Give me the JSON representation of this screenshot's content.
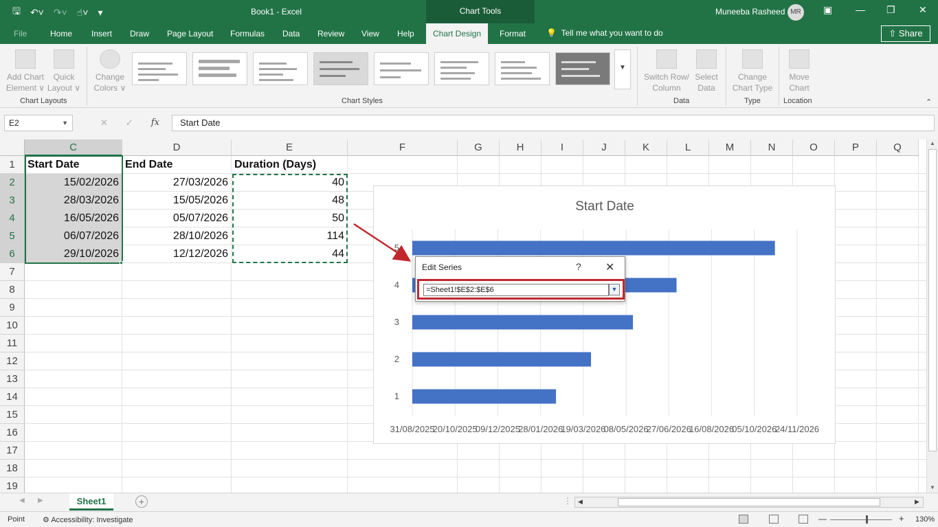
{
  "titlebar": {
    "doc_title": "Book1  -  Excel",
    "context_group": "Chart Tools",
    "user_name": "Muneeba Rasheed",
    "user_initials": "MR"
  },
  "tabs": [
    "File",
    "Home",
    "Insert",
    "Draw",
    "Page Layout",
    "Formulas",
    "Data",
    "Review",
    "View",
    "Help",
    "Chart Design",
    "Format"
  ],
  "active_tab": "Chart Design",
  "tell_me": "Tell me what you want to do",
  "share_label": "Share",
  "ribbon": {
    "add_chart_element": [
      "Add Chart",
      "Element ∨"
    ],
    "quick_layout": [
      "Quick",
      "Layout ∨"
    ],
    "chart_layouts_label": "Chart Layouts",
    "change_colors": [
      "Change",
      "Colors ∨"
    ],
    "chart_styles_label": "Chart Styles",
    "switch_row_col": [
      "Switch Row/",
      "Column"
    ],
    "select_data": [
      "Select",
      "Data"
    ],
    "data_label": "Data",
    "change_chart_type": [
      "Change",
      "Chart Type"
    ],
    "type_label": "Type",
    "move_chart": [
      "Move",
      "Chart"
    ],
    "location_label": "Location"
  },
  "formula_bar": {
    "name_box": "E2",
    "formula": "Start Date"
  },
  "columns": [
    "C",
    "D",
    "E",
    "F",
    "G",
    "H",
    "I",
    "J",
    "K",
    "L",
    "M",
    "N",
    "O",
    "P",
    "Q"
  ],
  "rows": [
    "1",
    "2",
    "3",
    "4",
    "5",
    "6",
    "7",
    "8",
    "9",
    "10",
    "11",
    "12",
    "13",
    "14",
    "15",
    "16",
    "17",
    "18",
    "19"
  ],
  "sheet": {
    "headers": [
      "Start Date",
      "End Date",
      "Duration (Days)"
    ],
    "data": [
      [
        "15/02/2026",
        "27/03/2026",
        "40"
      ],
      [
        "28/03/2026",
        "15/05/2026",
        "48"
      ],
      [
        "16/05/2026",
        "05/07/2026",
        "50"
      ],
      [
        "06/07/2026",
        "28/10/2026",
        "114"
      ],
      [
        "29/10/2026",
        "12/12/2026",
        "44"
      ]
    ]
  },
  "chart_data": {
    "type": "bar",
    "orientation": "horizontal",
    "title": "Start Date",
    "categories": [
      "1",
      "2",
      "3",
      "4",
      "5"
    ],
    "values": [
      "2026-02-15",
      "2026-03-28",
      "2026-05-16",
      "2026-07-06",
      "2026-10-29"
    ],
    "x_tick_labels": [
      "31/08/2025",
      "20/10/2025",
      "09/12/2025",
      "28/01/2026",
      "19/03/2026",
      "08/05/2026",
      "27/06/2026",
      "16/08/2026",
      "05/10/2026",
      "24/11/2026"
    ],
    "xlim": [
      "2025-08-31",
      "2026-11-24"
    ],
    "bar_color": "#4472c4",
    "grid": true
  },
  "dialog": {
    "title": "Edit Series",
    "help": "?",
    "close": "✕",
    "input_value": "=Sheet1!$E$2:$E$6"
  },
  "sheet_tabs": [
    "Sheet1"
  ],
  "status": {
    "mode": "Point",
    "accessibility": "Accessibility: Investigate",
    "zoom": "130%"
  },
  "colors": {
    "excel_green": "#217346",
    "highlight_red": "#c0282e",
    "bar_blue": "#4472c4"
  }
}
